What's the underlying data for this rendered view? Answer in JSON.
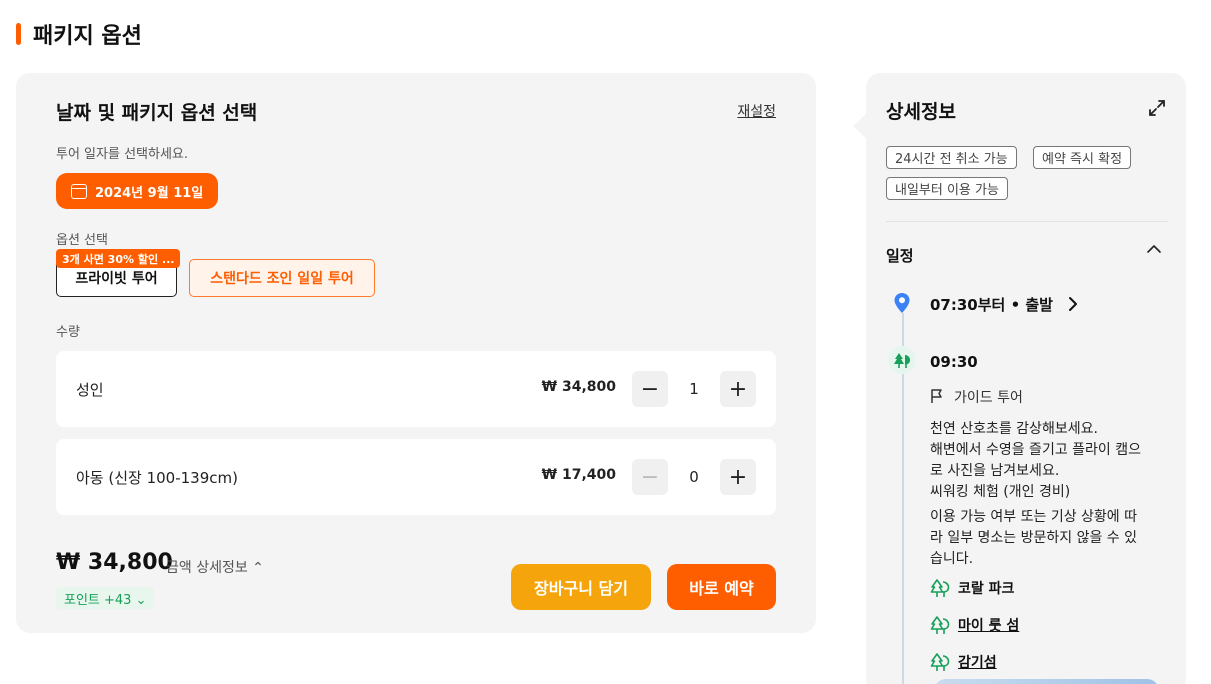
{
  "section": {
    "title": "패키지 옵션"
  },
  "selection": {
    "title": "날짜 및 패키지 옵션 선택",
    "reset_label": "재설정",
    "date_hint": "투어 일자를 선택하세요.",
    "date_value": "2024년 9월 11일",
    "option_label": "옵션 선택",
    "options": [
      {
        "label": "프라이빗 투어",
        "badge": "3개 사면 30% 할인 ...",
        "selected": false
      },
      {
        "label": "스탠다드 조인 일일 투어",
        "selected": true
      }
    ],
    "quantity_label": "수량",
    "quantities": [
      {
        "name": "성인",
        "price": "₩ 34,800",
        "count": "1",
        "minus": "−",
        "plus": "+"
      },
      {
        "name": "아동 (신장 100-139cm)",
        "price": "₩ 17,400",
        "count": "0",
        "minus": "−",
        "plus": "+"
      }
    ],
    "total": "₩ 34,800",
    "price_detail_label": "금액 상세정보 ⌃",
    "points_label": "포인트 +43 ⌄",
    "cart_label": "장바구니 담기",
    "book_label": "바로 예약"
  },
  "details": {
    "title": "상세정보",
    "tags": [
      "24시간 전 취소 가능",
      "예약 즉시 확정",
      "내일부터 이용 가능"
    ],
    "schedule_title": "일정",
    "start_time": "07:30부터 • 출발",
    "stop_time": "09:30",
    "guide_label": "가이드 투어",
    "description_lines": [
      "천연 산호초를 감상해보세요.",
      "해변에서 수영을 즐기고 플라이 캠으",
      "로 사진을 남겨보세요.",
      "씨워킹 체험 (개인 경비)"
    ],
    "notice_lines": [
      "이용 가능 여부 또는 기상 상황에 따",
      "라 일부 명소는 방문하지 않을 수 있",
      "습니다."
    ],
    "places": [
      {
        "name": "코랄 파크",
        "link": false
      },
      {
        "name": "마이 룻 섬",
        "link": true
      },
      {
        "name": "감기섬",
        "link": true
      }
    ]
  },
  "colors": {
    "accent": "#ff5e00",
    "cart": "#f5a50b",
    "points": "#16a05a",
    "pin": "#3b82f6",
    "place_icon": "#16a05a"
  },
  "icons": [
    "calendar-icon",
    "expand-icon",
    "chevron-up-icon",
    "map-pin-icon",
    "chevron-right-icon",
    "tree-icon",
    "flag-icon"
  ]
}
